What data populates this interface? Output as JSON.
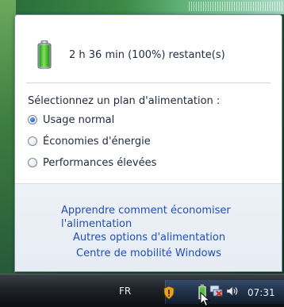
{
  "flyout": {
    "status": "2 h 36 min (100%) restante(s)",
    "battery_level": 1.0,
    "plan_heading": "Sélectionnez un plan d'alimentation :",
    "plans": [
      {
        "label": "Usage normal",
        "selected": true
      },
      {
        "label": "Économies d'énergie",
        "selected": false
      },
      {
        "label": "Performances élevées",
        "selected": false
      }
    ],
    "links": {
      "learn": "Apprendre comment économiser l'alimentation",
      "more_options": "Autres options d'alimentation",
      "mobility": "Centre de mobilité Windows"
    }
  },
  "taskbar": {
    "language": "FR",
    "clock": "07:31",
    "tray_icons": [
      "shield-warning-icon",
      "battery-icon",
      "network-disconnected-icon",
      "speaker-icon"
    ]
  },
  "colors": {
    "link": "#1f4fb5",
    "text": "#1e2b3c",
    "battery_green": "#3bbf2f",
    "taskbar": "#1e2227"
  }
}
